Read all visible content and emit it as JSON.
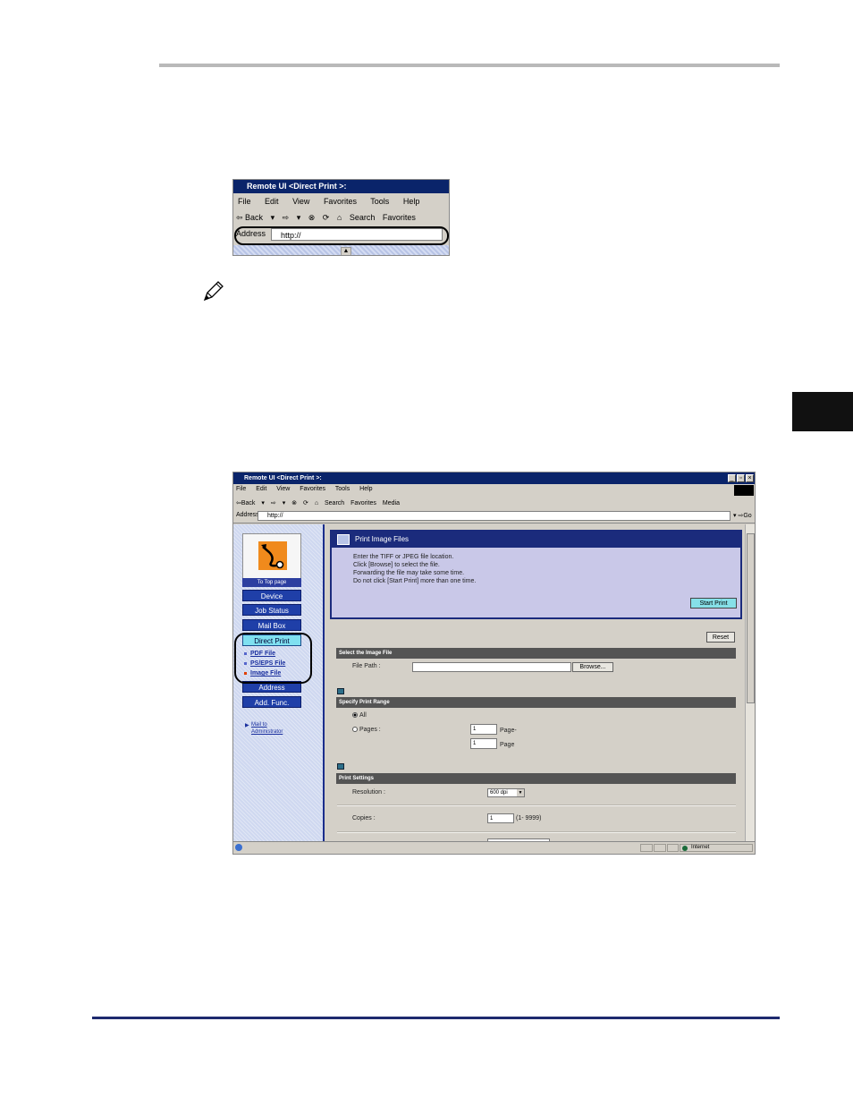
{
  "small_browser": {
    "title": "Remote UI <Direct Print >:",
    "menu": [
      "File",
      "Edit",
      "View",
      "Favorites",
      "Tools",
      "Help"
    ],
    "toolbar": [
      "⇦ Back",
      "▾",
      "⇨",
      "▾",
      "⊗",
      "⟳",
      "⌂",
      "Search",
      "Favorites"
    ],
    "address_label": "Address",
    "address_value": "http://"
  },
  "browser": {
    "title": "Remote UI <Direct Print >:",
    "menu": [
      "File",
      "Edit",
      "View",
      "Favorites",
      "Tools",
      "Help"
    ],
    "toolbar": [
      "⇦Back",
      "▾",
      "⇨",
      "▾",
      "⊗",
      "⟳",
      "⌂",
      "Search",
      "Favorites",
      "Media"
    ],
    "address_label": "Address",
    "address_value": "http://",
    "go_label": "Go",
    "status_zone": "Internet"
  },
  "nav": {
    "top_page": "To Top page",
    "buttons": [
      "Device",
      "Job Status",
      "Mail Box",
      "Direct Print"
    ],
    "sublinks": [
      "PDF File",
      "PS/EPS File",
      "Image File"
    ],
    "buttons_after": [
      "Address",
      "Add. Func."
    ],
    "mail_line1": "Mail to",
    "mail_line2": "Administrator"
  },
  "main": {
    "panel_title": "Print Image Files",
    "panel_lines": [
      "Enter the TIFF or JPEG file location.",
      "Click [Browse] to select the file.",
      "Forwarding the file may take some time.",
      "Do not click [Start Print] more than one time."
    ],
    "start_print": "Start Print",
    "reset": "Reset",
    "select_image_header": "Select the Image File",
    "file_path_label": "File Path :",
    "browse": "Browse...",
    "print_range_header": "Specify Print Range",
    "all_label": "All",
    "pages_label": "Pages :",
    "from_value": "1",
    "from_suffix": "Page-",
    "to_value": "1",
    "to_suffix": "Page",
    "print_settings_header": "Print Settings",
    "resolution_label": "Resolution :",
    "resolution_value": "600 dpi",
    "copies_label": "Copies :",
    "copies_value": "1",
    "copies_range": "(1- 9999)"
  }
}
